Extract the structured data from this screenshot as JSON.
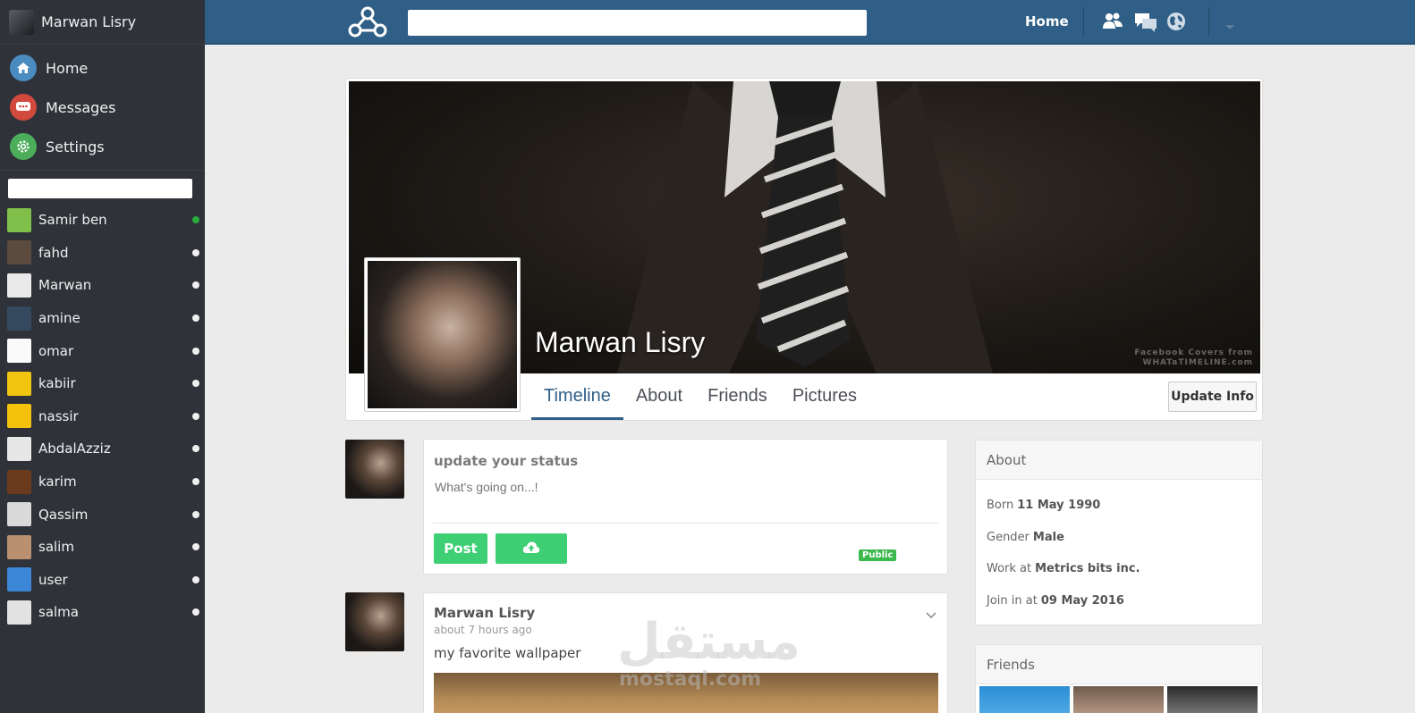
{
  "sidebar": {
    "user_name": "Marwan Lisry",
    "nav": [
      {
        "label": "Home",
        "icon": "home-icon",
        "color": "#4a8bc0"
      },
      {
        "label": "Messages",
        "icon": "chat-bubble-icon",
        "color": "#d24a3e"
      },
      {
        "label": "Settings",
        "icon": "gear-icon",
        "color": "#4cae5a"
      }
    ],
    "search_placeholder": "",
    "contacts": [
      {
        "name": "Samir ben",
        "online": true
      },
      {
        "name": "fahd",
        "online": false
      },
      {
        "name": "Marwan",
        "online": false
      },
      {
        "name": "amine",
        "online": false
      },
      {
        "name": "omar",
        "online": false
      },
      {
        "name": "kabiir",
        "online": false
      },
      {
        "name": "nassir",
        "online": false
      },
      {
        "name": "AbdalAzziz",
        "online": false
      },
      {
        "name": "karim",
        "online": false
      },
      {
        "name": "Qassim",
        "online": false
      },
      {
        "name": "salim",
        "online": false
      },
      {
        "name": "user",
        "online": false
      },
      {
        "name": "salma",
        "online": false
      }
    ]
  },
  "topbar": {
    "search_placeholder": "",
    "home_label": "Home",
    "icons": [
      "friends-icon",
      "messages-icon",
      "globe-icon",
      "dropdown-caret-icon"
    ]
  },
  "profile": {
    "name": "Marwan Lisry",
    "cover_credit_line1": "Facebook Covers from",
    "cover_credit_line2": "WHATaTIMELINE.com",
    "tabs": [
      "Timeline",
      "About",
      "Friends",
      "Pictures"
    ],
    "active_tab": "Timeline",
    "update_button": "Update Info"
  },
  "status": {
    "title": "update your status",
    "placeholder": "What's going on...!",
    "post_button": "Post",
    "upload_icon": "cloud-upload-icon",
    "privacy_badge": "Public"
  },
  "post": {
    "author": "Marwan Lisry",
    "time": "about 7 hours ago",
    "text": "my favorite wallpaper"
  },
  "about": {
    "title": "About",
    "rows": [
      {
        "label": "Born",
        "value": "11 May 1990"
      },
      {
        "label": "Gender",
        "value": "Male"
      },
      {
        "label": "Work at",
        "value": "Metrics bits inc."
      },
      {
        "label": "Join in at",
        "value": "09 May 2016"
      }
    ]
  },
  "friends": {
    "title": "Friends"
  },
  "watermark": {
    "arabic": "مستقل",
    "latin": "mostaql.com"
  }
}
